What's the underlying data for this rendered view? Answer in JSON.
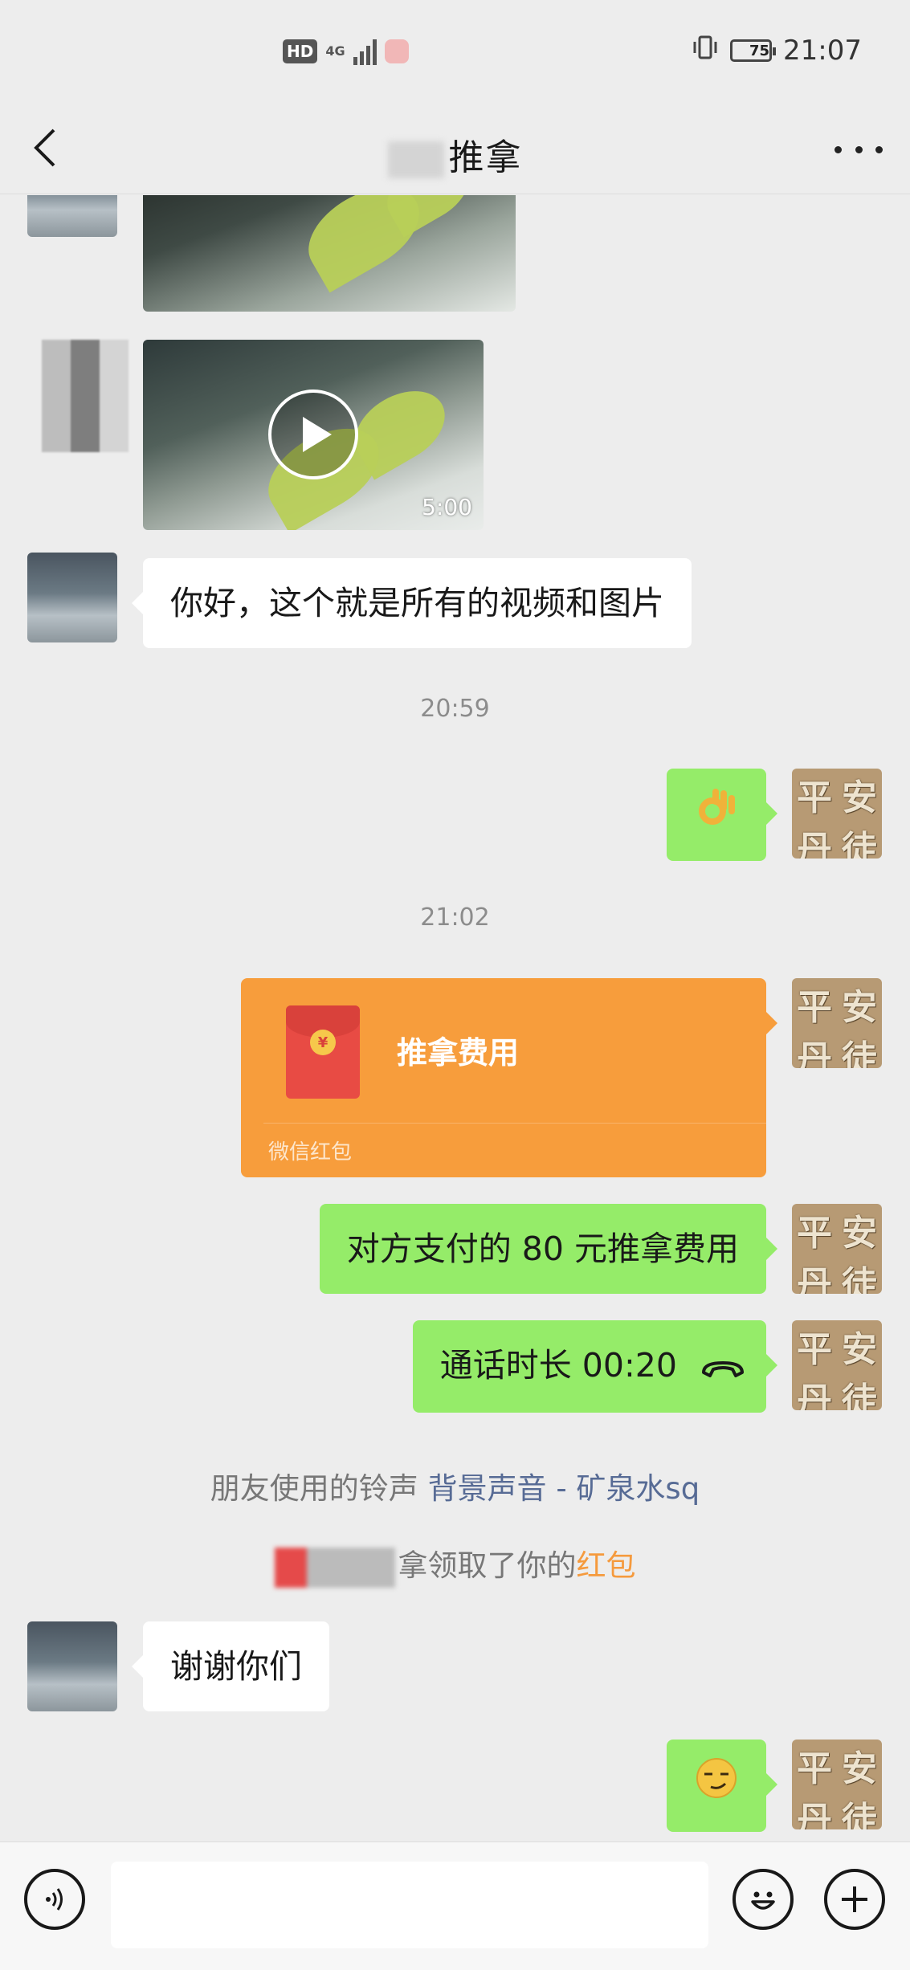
{
  "status_bar": {
    "hd": "HD",
    "network": "4G",
    "battery": "75",
    "time": "21:07"
  },
  "nav": {
    "title": "推拿"
  },
  "messages": {
    "video_duration": "5:00",
    "greeting": "你好，这个就是所有的视频和图片",
    "time1": "20:59",
    "time2": "21:02",
    "red_packet_title": "推拿费用",
    "red_packet_footer": "微信红包",
    "payment": "对方支付的 80 元推拿费用",
    "call_duration": "通话时长 00:20",
    "thanks": "谢谢你们"
  },
  "my_avatar": [
    "平",
    "安",
    "丹",
    "徒"
  ],
  "notices": {
    "ringtone_prefix": "朋友使用的铃声",
    "ringtone_link": "背景声音 - 矿泉水sq",
    "received_suffix": "拿领取了你的",
    "received_link": "红包"
  },
  "input": {
    "placeholder": ""
  },
  "colors": {
    "outgoing_bubble": "#95ec69",
    "incoming_bubble": "#ffffff",
    "red_packet": "#f79d3c",
    "link": "#576b95"
  },
  "icons": [
    "back-icon",
    "more-icon",
    "play-icon",
    "ok-hand-emoji",
    "phone-hangup-icon",
    "smirk-emoji",
    "voice-icon",
    "emoji-icon",
    "plus-icon"
  ]
}
